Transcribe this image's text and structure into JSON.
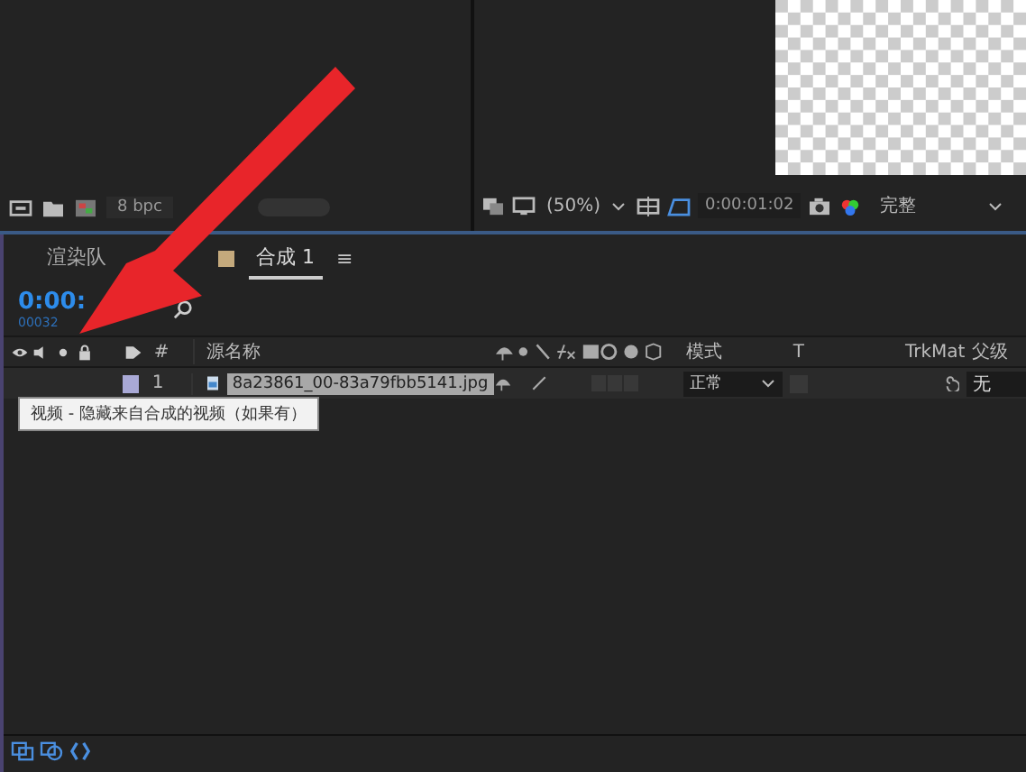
{
  "project_panel": {
    "bit_depth": "8 bpc"
  },
  "viewer": {
    "zoom": "(50%)",
    "timecode": "0:00:01:02",
    "resolution": "完整"
  },
  "timeline": {
    "tabs": [
      {
        "label": "渲染队",
        "selected": false
      },
      {
        "label": "合成 1",
        "selected": true
      }
    ],
    "menu_glyph": "≡",
    "current_time": "0:00:",
    "frame_count": "00032",
    "columns": {
      "number": "#",
      "source_name": "源名称",
      "mode": "模式",
      "t": "T",
      "trkmat": "TrkMat",
      "parent": "父级"
    },
    "layers": [
      {
        "number": "1",
        "name": "8a23861_00-83a79fbb5141.jpg",
        "mode": "正常",
        "parent": "无",
        "selected": true
      }
    ],
    "tooltip": "视频 - 隐藏来自合成的视频（如果有）"
  }
}
